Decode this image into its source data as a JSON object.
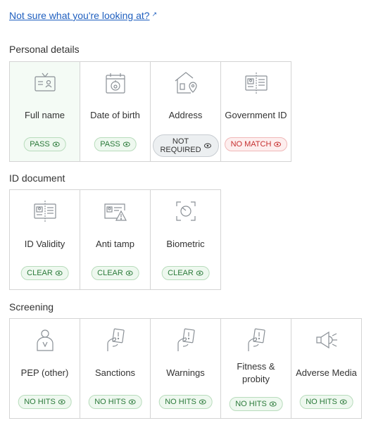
{
  "help_link": {
    "text": "Not sure what you're looking at?",
    "ext_glyph": "↗"
  },
  "sections": {
    "personal": {
      "title": "Personal details",
      "cards": [
        {
          "label": "Full name",
          "status": "PASS",
          "status_color": "green",
          "icon": "id-card-icon"
        },
        {
          "label": "Date of birth",
          "status": "PASS",
          "status_color": "green",
          "icon": "calendar-cake-icon"
        },
        {
          "label": "Address",
          "status": "NOT REQUIRED",
          "status_line1": "NOT",
          "status_line2": "REQUIRED",
          "status_color": "grey",
          "icon": "house-pin-icon"
        },
        {
          "label": "Government ID",
          "status": "NO MATCH",
          "status_color": "red",
          "icon": "id-document-icon"
        }
      ]
    },
    "id_document": {
      "title": "ID document",
      "cards": [
        {
          "label": "ID Validity",
          "status": "CLEAR",
          "status_color": "green",
          "icon": "id-document-icon"
        },
        {
          "label": "Anti tamp",
          "status": "CLEAR",
          "status_color": "green",
          "icon": "id-warning-icon"
        },
        {
          "label": "Biometric",
          "status": "CLEAR",
          "status_color": "green",
          "icon": "face-scan-icon"
        }
      ]
    },
    "screening": {
      "title": "Screening",
      "cards": [
        {
          "label": "PEP (other)",
          "status": "NO HITS",
          "status_color": "green",
          "icon": "person-icon"
        },
        {
          "label": "Sanctions",
          "status": "NO HITS",
          "status_color": "green",
          "icon": "hand-alert-card-icon"
        },
        {
          "label": "Warnings",
          "status": "NO HITS",
          "status_color": "green",
          "icon": "hand-alert-card-icon"
        },
        {
          "label": "Fitness & probity",
          "label_line1": "Fitness &",
          "label_line2": "probity",
          "status": "NO HITS",
          "status_color": "green",
          "icon": "hand-alert-card-icon"
        },
        {
          "label": "Adverse Media",
          "status": "NO HITS",
          "status_color": "green",
          "icon": "megaphone-icon"
        }
      ]
    }
  },
  "colors": {
    "link": "#1f5fbf",
    "pass_green": "#2b7a3a",
    "fail_red": "#c62f2f",
    "border": "#d4d4d4",
    "icon_grey": "#8a9096"
  }
}
